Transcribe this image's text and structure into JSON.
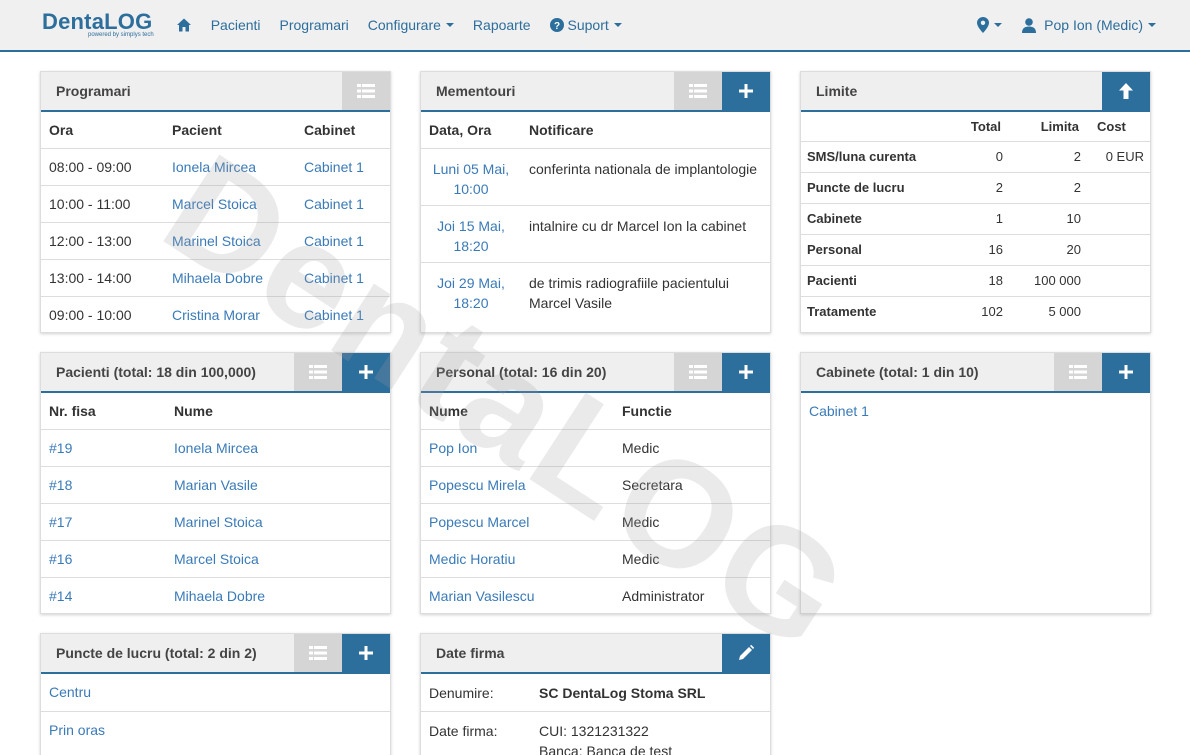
{
  "brand": {
    "name_a": "Denta",
    "name_b": "LOG",
    "tagline": "powered by simplys tech"
  },
  "nav": {
    "items": [
      {
        "label": "Pacienti"
      },
      {
        "label": "Programari"
      },
      {
        "label": "Configurare"
      },
      {
        "label": "Rapoarte"
      },
      {
        "label": "Suport"
      }
    ],
    "user": "Pop Ion (Medic)"
  },
  "programari": {
    "title": "Programari",
    "headers": [
      "Ora",
      "Pacient",
      "Cabinet"
    ],
    "rows": [
      [
        "08:00 - 09:00",
        "Ionela Mircea",
        "Cabinet 1"
      ],
      [
        "10:00 - 11:00",
        "Marcel Stoica",
        "Cabinet 1"
      ],
      [
        "12:00 - 13:00",
        "Marinel Stoica",
        "Cabinet 1"
      ],
      [
        "13:00 - 14:00",
        "Mihaela Dobre",
        "Cabinet 1"
      ],
      [
        "09:00 - 10:00",
        "Cristina Morar",
        "Cabinet 1"
      ]
    ]
  },
  "mementouri": {
    "title": "Mementouri",
    "headers": [
      "Data, Ora",
      "Notificare"
    ],
    "rows": [
      {
        "d1": "Luni 05 Mai,",
        "d2": "10:00",
        "n1": "conferinta nationala de implantologie",
        "n2": ""
      },
      {
        "d1": "Joi 15 Mai,",
        "d2": "18:20",
        "n1": "intalnire cu dr Marcel Ion la cabinet",
        "n2": ""
      },
      {
        "d1": "Joi 29 Mai,",
        "d2": "18:20",
        "n1": "de trimis radiografiile pacientului",
        "n2": "Marcel Vasile"
      }
    ]
  },
  "limite": {
    "title": "Limite",
    "headers": [
      "",
      "Total",
      "Limita",
      "Cost"
    ],
    "rows": [
      [
        "SMS/luna curenta",
        "0",
        "2",
        "0 EUR"
      ],
      [
        "Puncte de lucru",
        "2",
        "2",
        ""
      ],
      [
        "Cabinete",
        "1",
        "10",
        ""
      ],
      [
        "Personal",
        "16",
        "20",
        ""
      ],
      [
        "Pacienti",
        "18",
        "100 000",
        ""
      ],
      [
        "Tratamente",
        "102",
        "5 000",
        ""
      ]
    ]
  },
  "pacienti": {
    "title": "Pacienti (total: 18 din 100,000)",
    "headers": [
      "Nr. fisa",
      "Nume"
    ],
    "rows": [
      [
        "#19",
        "Ionela Mircea"
      ],
      [
        "#18",
        "Marian Vasile"
      ],
      [
        "#17",
        "Marinel Stoica"
      ],
      [
        "#16",
        "Marcel Stoica"
      ],
      [
        "#14",
        "Mihaela Dobre"
      ]
    ]
  },
  "personal": {
    "title": "Personal (total: 16 din 20)",
    "headers": [
      "Nume",
      "Functie"
    ],
    "rows": [
      [
        "Pop Ion",
        "Medic"
      ],
      [
        "Popescu Mirela",
        "Secretara"
      ],
      [
        "Popescu Marcel",
        "Medic"
      ],
      [
        "Medic Horatiu",
        "Medic"
      ],
      [
        "Marian Vasilescu",
        "Administrator"
      ]
    ]
  },
  "cabinete": {
    "title": "Cabinete (total: 1 din 10)",
    "items": [
      "Cabinet 1"
    ]
  },
  "puncte": {
    "title": "Puncte de lucru (total: 2 din 2)",
    "items": [
      "Centru",
      "Prin oras"
    ]
  },
  "firma": {
    "title": "Date firma",
    "denumire_label": "Denumire:",
    "denumire": "SC DentaLog Stoma SRL",
    "date_label": "Date firma:",
    "cui": "CUI: 1321231322",
    "banca": "Banca: Banca de test"
  },
  "watermark": "DentaLOG",
  "colors": {
    "accent": "#2c6e9c",
    "link": "#3a7ab8",
    "header_bg": "#efefef"
  }
}
